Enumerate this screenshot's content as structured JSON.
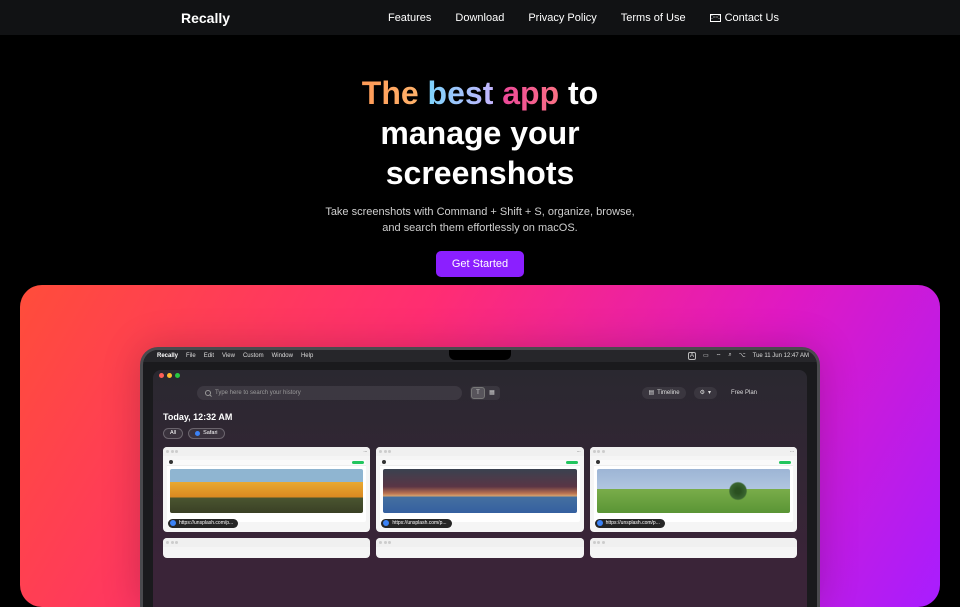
{
  "brand": "Recally",
  "nav": {
    "features": "Features",
    "download": "Download",
    "privacy": "Privacy Policy",
    "terms": "Terms of Use",
    "contact": "Contact Us"
  },
  "hero": {
    "w1": "The",
    "w2": "best",
    "w3": "app",
    "w4": "to",
    "line2": "manage your",
    "line3": "screenshots",
    "subtitle": "Take screenshots with Command + Shift + S, organize, browse, and search them effortlessly on macOS.",
    "cta": "Get Started"
  },
  "mac": {
    "menubar": {
      "app": "Recally",
      "items": [
        "File",
        "Edit",
        "View",
        "Custom",
        "Window",
        "Help"
      ],
      "lang": "A",
      "clock": "Tue 11 Jun  12:47 AM"
    },
    "app": {
      "search_placeholder": "Type here to search your history",
      "seg_text": "T",
      "timeline": "Timeline",
      "plan": "Free Plan",
      "section_title": "Today, 12:32 AM",
      "filter_all": "All",
      "filter_safari": "Safari",
      "card_url": "https://unsplash.com/p..."
    }
  }
}
